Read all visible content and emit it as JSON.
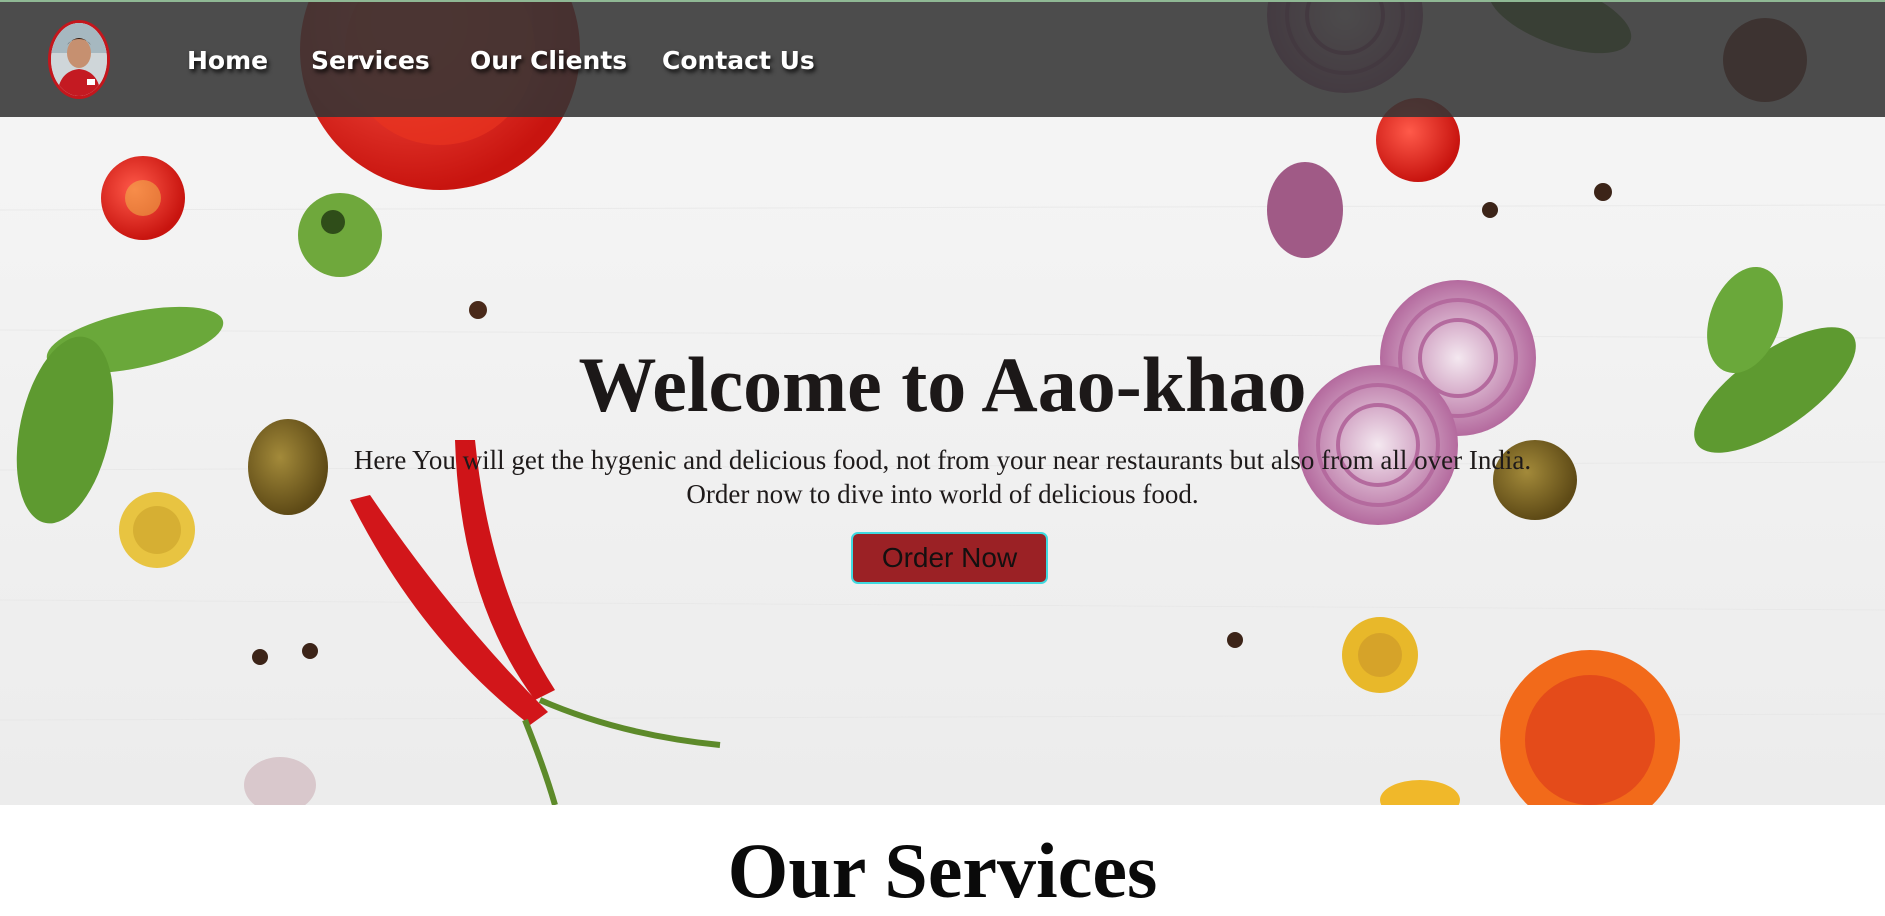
{
  "nav": {
    "avatar_alt": "profile photo",
    "links": [
      {
        "label": "Home"
      },
      {
        "label": "Services"
      },
      {
        "label": "Our Clients"
      },
      {
        "label": "Contact Us"
      }
    ]
  },
  "hero": {
    "title": "Welcome to Aao-khao",
    "description_line1": "Here You will get the hygenic and delicious food, not from your near restaurants but also from all over India.",
    "description_line2": "Order now to dive into world of delicious food.",
    "order_button_label": "Order Now"
  },
  "services": {
    "title": "Our Services"
  },
  "colors": {
    "navbar_bg": "#343434",
    "button_bg": "#9b2125",
    "button_border": "#3fd9df",
    "avatar_border": "#c4161c"
  }
}
